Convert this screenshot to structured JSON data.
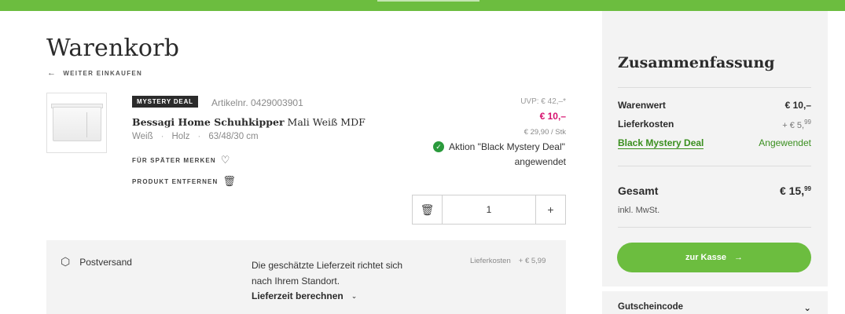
{
  "colors": {
    "brand_green": "#6cbd3f",
    "price_pink": "#d6116e",
    "success_green": "#2a9a3c",
    "panel_grey": "#f3f3f3"
  },
  "page": {
    "title": "Warenkorb",
    "back_link": "WEITER EINKAUFEN",
    "back_icon": "arrow-left-icon"
  },
  "product": {
    "badge": "MYSTERY DEAL",
    "article_nr": "Artikelnr. 0429003901",
    "name_bold": "Bessagi Home Schuhkipper",
    "name_rest": "Mali Weiß MDF",
    "variant": [
      "Weiß",
      "Holz",
      "63/48/30 cm"
    ],
    "variant_sep": "·",
    "save_label": "FÜR SPÄTER MERKEN",
    "save_icon": "heart-icon",
    "remove_label": "PRODUKT ENTFERNEN",
    "remove_icon": "trash-icon",
    "uvp": "UVP: € 42,–*",
    "price": "€ 10,–",
    "unit_price": "€ 29,90 / Stk",
    "action_text": "Aktion \"Black Mystery Deal\"",
    "action_status": "angewendet",
    "quantity": "1",
    "qty_plus": "+"
  },
  "shipping": {
    "title": "Postversand",
    "description": "Die geschätzte Lieferzeit richtet sich nach Ihrem Standort.",
    "calc_label": "Lieferzeit berechnen",
    "cost_label": "Lieferkosten",
    "cost_value": "+ € 5,99"
  },
  "summary": {
    "title": "Zusammenfassung",
    "warenwert_label": "Warenwert",
    "warenwert_value": "€ 10,–",
    "lieferkosten_label": "Lieferkosten",
    "lieferkosten_value": "+ € 5,",
    "lieferkosten_cents": "99",
    "deal_label": "Black Mystery Deal",
    "deal_status": "Angewendet",
    "total_label": "Gesamt",
    "total_value": "€ 15,",
    "total_cents": "99",
    "tax_note": "inkl. MwSt.",
    "checkout_label": "zur Kasse",
    "coupon_label": "Gutscheincode"
  }
}
